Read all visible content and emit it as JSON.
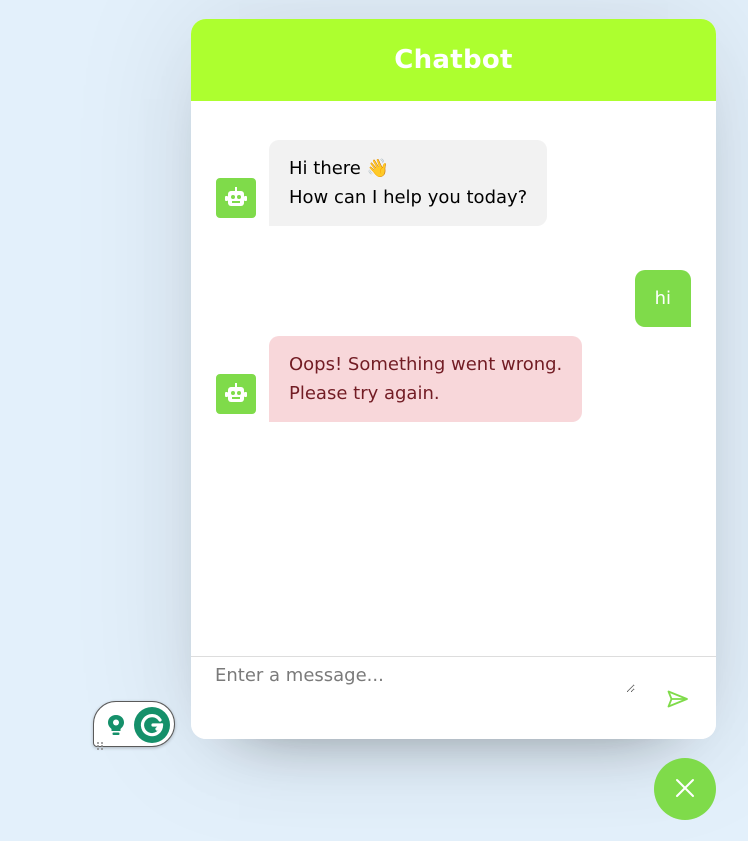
{
  "header": {
    "title": "Chatbot"
  },
  "messages": [
    {
      "role": "bot",
      "text": "Hi there 👋\nHow can I help you today?"
    },
    {
      "role": "user",
      "text": "hi"
    },
    {
      "role": "bot-error",
      "text": "Oops! Something went wrong.\nPlease try again."
    }
  ],
  "input": {
    "placeholder": "Enter a message...",
    "value": ""
  },
  "icons": {
    "bot_avatar": "robot-icon",
    "send": "send-icon",
    "toggler": "close-icon",
    "grammarly_bulb": "lightbulb-icon",
    "grammarly_logo": "grammarly-g-icon"
  },
  "colors": {
    "header": "#adff2f",
    "accent": "#7fdb4a",
    "incoming_bg": "#f2f2f2",
    "error_bg": "#f8d7da",
    "error_text": "#721c24",
    "page_bg": "#e3f0fb"
  }
}
